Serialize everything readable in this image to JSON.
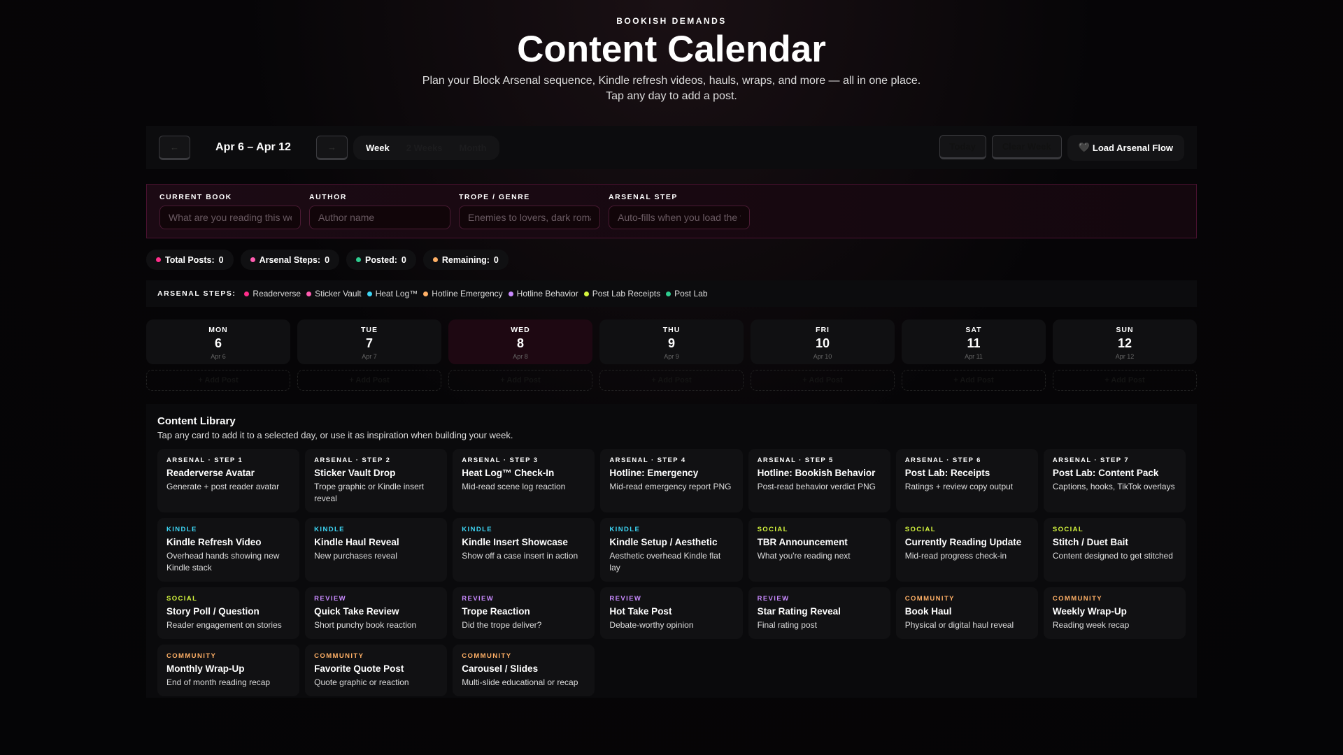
{
  "header": {
    "brand": "BOOKISH DEMANDS",
    "title": "Content Calendar",
    "subtitle": "Plan your Block Arsenal sequence, Kindle refresh videos, hauls, wraps, and more — all in one place. Tap any day to add a post."
  },
  "toolbar": {
    "prev": "←",
    "next": "→",
    "range": "Apr 6 – Apr 12",
    "views": [
      "Week",
      "2 Weeks",
      "Month"
    ],
    "active_view": "Week",
    "today": "Today",
    "clear": "Clear Week",
    "load_icon": "🖤",
    "load": "Load Arsenal Flow"
  },
  "form": {
    "fields": [
      {
        "label": "CURRENT BOOK",
        "placeholder": "What are you reading this week?"
      },
      {
        "label": "AUTHOR",
        "placeholder": "Author name"
      },
      {
        "label": "TROPE / GENRE",
        "placeholder": "Enemies to lovers, dark romance..."
      },
      {
        "label": "ARSENAL STEP",
        "placeholder": "Auto-fills when you load the flow"
      }
    ]
  },
  "stats": [
    {
      "label": "Total Posts:",
      "value": "0",
      "color": "#ff2d8a"
    },
    {
      "label": "Arsenal Steps:",
      "value": "0",
      "color": "#ff5cb0"
    },
    {
      "label": "Posted:",
      "value": "0",
      "color": "#2ecc8f"
    },
    {
      "label": "Remaining:",
      "value": "0",
      "color": "#ffb066"
    }
  ],
  "legend": {
    "title": "ARSENAL STEPS:",
    "items": [
      {
        "label": "Readerverse",
        "color": "#ff2d8a"
      },
      {
        "label": "Sticker Vault",
        "color": "#ff5cb0"
      },
      {
        "label": "Heat Log™",
        "color": "#3dd6f5"
      },
      {
        "label": "Hotline Emergency",
        "color": "#ffb066"
      },
      {
        "label": "Hotline Behavior",
        "color": "#c98aff"
      },
      {
        "label": "Post Lab Receipts",
        "color": "#d4f53d"
      },
      {
        "label": "Post Lab",
        "color": "#2ecc8f"
      }
    ]
  },
  "days": [
    {
      "name": "MON",
      "num": "6",
      "date": "Apr 6"
    },
    {
      "name": "TUE",
      "num": "7",
      "date": "Apr 7"
    },
    {
      "name": "WED",
      "num": "8",
      "date": "Apr 8",
      "today": true
    },
    {
      "name": "THU",
      "num": "9",
      "date": "Apr 9"
    },
    {
      "name": "FRI",
      "num": "10",
      "date": "Apr 10"
    },
    {
      "name": "SAT",
      "num": "11",
      "date": "Apr 11"
    },
    {
      "name": "SUN",
      "num": "12",
      "date": "Apr 12"
    }
  ],
  "add_post": "+ Add Post",
  "library": {
    "title": "Content Library",
    "desc": "Tap any card to add it to a selected day, or use it as inspiration when building your week.",
    "colors": {
      "arsenal": "#ffffff",
      "kindle": "#3dd6f5",
      "social": "#d4f53d",
      "review": "#c98aff",
      "community": "#ffb066"
    },
    "cards": [
      {
        "tag": "ARSENAL · STEP 1",
        "type": "arsenal",
        "title": "Readerverse Avatar",
        "desc": "Generate + post reader avatar"
      },
      {
        "tag": "ARSENAL · STEP 2",
        "type": "arsenal",
        "title": "Sticker Vault Drop",
        "desc": "Trope graphic or Kindle insert reveal"
      },
      {
        "tag": "ARSENAL · STEP 3",
        "type": "arsenal",
        "title": "Heat Log™ Check-In",
        "desc": "Mid-read scene log reaction"
      },
      {
        "tag": "ARSENAL · STEP 4",
        "type": "arsenal",
        "title": "Hotline: Emergency",
        "desc": "Mid-read emergency report PNG"
      },
      {
        "tag": "ARSENAL · STEP 5",
        "type": "arsenal",
        "title": "Hotline: Bookish Behavior",
        "desc": "Post-read behavior verdict PNG"
      },
      {
        "tag": "ARSENAL · STEP 6",
        "type": "arsenal",
        "title": "Post Lab: Receipts",
        "desc": "Ratings + review copy output"
      },
      {
        "tag": "ARSENAL · STEP 7",
        "type": "arsenal",
        "title": "Post Lab: Content Pack",
        "desc": "Captions, hooks, TikTok overlays"
      },
      {
        "tag": "KINDLE",
        "type": "kindle",
        "title": "Kindle Refresh Video",
        "desc": "Overhead hands showing new Kindle stack"
      },
      {
        "tag": "KINDLE",
        "type": "kindle",
        "title": "Kindle Haul Reveal",
        "desc": "New purchases reveal"
      },
      {
        "tag": "KINDLE",
        "type": "kindle",
        "title": "Kindle Insert Showcase",
        "desc": "Show off a case insert in action"
      },
      {
        "tag": "KINDLE",
        "type": "kindle",
        "title": "Kindle Setup / Aesthetic",
        "desc": "Aesthetic overhead Kindle flat lay"
      },
      {
        "tag": "SOCIAL",
        "type": "social",
        "title": "TBR Announcement",
        "desc": "What you're reading next"
      },
      {
        "tag": "SOCIAL",
        "type": "social",
        "title": "Currently Reading Update",
        "desc": "Mid-read progress check-in"
      },
      {
        "tag": "SOCIAL",
        "type": "social",
        "title": "Stitch / Duet Bait",
        "desc": "Content designed to get stitched"
      },
      {
        "tag": "SOCIAL",
        "type": "social",
        "title": "Story Poll / Question",
        "desc": "Reader engagement on stories"
      },
      {
        "tag": "REVIEW",
        "type": "review",
        "title": "Quick Take Review",
        "desc": "Short punchy book reaction"
      },
      {
        "tag": "REVIEW",
        "type": "review",
        "title": "Trope Reaction",
        "desc": "Did the trope deliver?"
      },
      {
        "tag": "REVIEW",
        "type": "review",
        "title": "Hot Take Post",
        "desc": "Debate-worthy opinion"
      },
      {
        "tag": "REVIEW",
        "type": "review",
        "title": "Star Rating Reveal",
        "desc": "Final rating post"
      },
      {
        "tag": "COMMUNITY",
        "type": "community",
        "title": "Book Haul",
        "desc": "Physical or digital haul reveal"
      },
      {
        "tag": "COMMUNITY",
        "type": "community",
        "title": "Weekly Wrap-Up",
        "desc": "Reading week recap"
      },
      {
        "tag": "COMMUNITY",
        "type": "community",
        "title": "Monthly Wrap-Up",
        "desc": "End of month reading recap"
      },
      {
        "tag": "COMMUNITY",
        "type": "community",
        "title": "Favorite Quote Post",
        "desc": "Quote graphic or reaction"
      },
      {
        "tag": "COMMUNITY",
        "type": "community",
        "title": "Carousel / Slides",
        "desc": "Multi-slide educational or recap"
      }
    ]
  }
}
